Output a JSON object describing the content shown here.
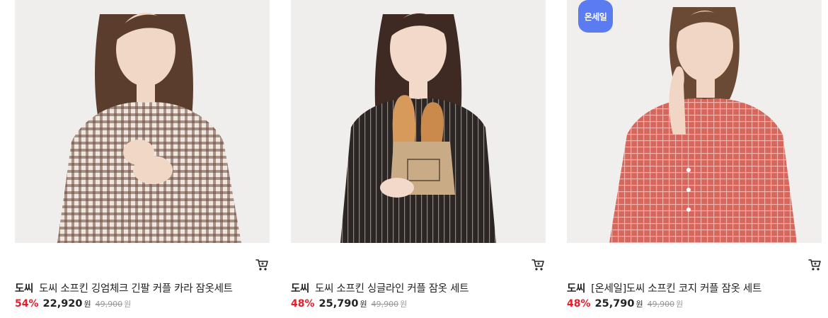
{
  "products": [
    {
      "brand": "도씨",
      "name": "도씨 소프킨 깅엄체크 긴팔 커플 카라 잠옷세트",
      "discount": "54%",
      "sale_price": "22,920",
      "original_price": "49,900",
      "currency": "원",
      "cart_icon": "cart-icon"
    },
    {
      "brand": "도씨",
      "name": "도씨 소프킨 싱글라인 커플 잠옷 세트",
      "discount": "48%",
      "sale_price": "25,790",
      "original_price": "49,900",
      "currency": "원",
      "cart_icon": "cart-icon"
    },
    {
      "brand": "도씨",
      "name": "[온세일]도씨 소프킨 코지 커플 잠옷 세트",
      "discount": "48%",
      "sale_price": "25,790",
      "original_price": "49,900",
      "currency": "원",
      "badge": "온세일",
      "cart_icon": "cart-icon"
    }
  ],
  "colors": {
    "discount": "#e0202b",
    "badge_bg": "#5b7cf0",
    "original_price": "#999999"
  }
}
